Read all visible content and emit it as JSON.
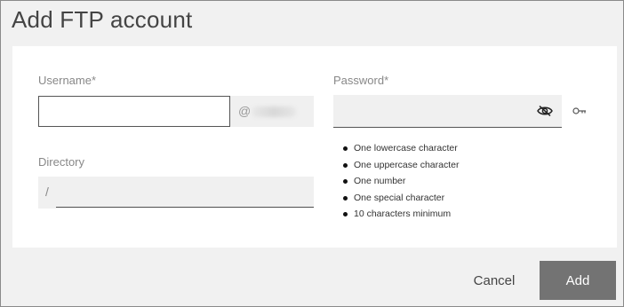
{
  "dialog": {
    "title": "Add FTP account"
  },
  "form": {
    "username": {
      "label": "Username*",
      "value": "",
      "at_symbol": "@"
    },
    "password": {
      "label": "Password*",
      "value": ""
    },
    "directory": {
      "label": "Directory",
      "prefix": "/",
      "value": ""
    },
    "requirements": [
      "One lowercase character",
      "One uppercase character",
      "One number",
      "One special character",
      "10 characters minimum"
    ]
  },
  "actions": {
    "cancel_label": "Cancel",
    "add_label": "Add"
  },
  "icons": {
    "visibility": "eye-off-icon",
    "generate": "key-icon"
  },
  "colors": {
    "add_button": "#737373",
    "background": "#f1f1f1",
    "field": "#f0f0f0"
  }
}
